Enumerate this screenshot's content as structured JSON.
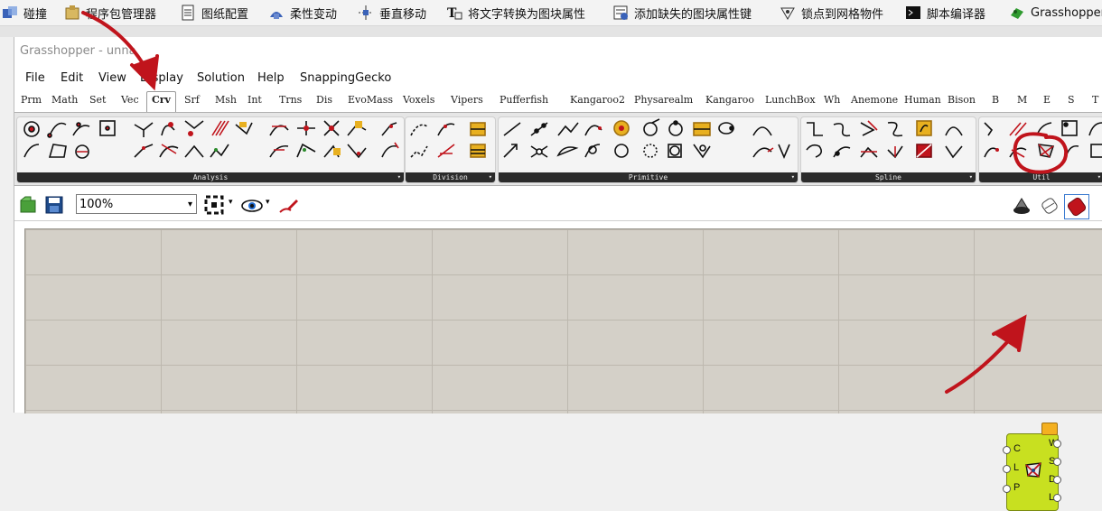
{
  "host_toolbar": {
    "items": [
      {
        "label": "碰撞",
        "icon": "collision-icon"
      },
      {
        "label": "程序包管理器",
        "icon": "package-manager-icon"
      },
      {
        "label": "图纸配置",
        "icon": "drawing-config-icon"
      },
      {
        "label": "柔性变动",
        "icon": "flex-transform-icon"
      },
      {
        "label": "垂直移动",
        "icon": "vertical-move-icon"
      },
      {
        "label": "将文字转换为图块属性",
        "icon": "text-to-block-icon"
      },
      {
        "label": "添加缺失的图块属性键",
        "icon": "add-block-key-icon"
      },
      {
        "label": "锁点到网格物件",
        "icon": "snap-to-mesh-icon"
      },
      {
        "label": "脚本编译器",
        "icon": "script-compiler-icon"
      },
      {
        "label": "Grasshopper",
        "icon": "grasshopper-icon"
      }
    ]
  },
  "window": {
    "title": "Grasshopper - unna"
  },
  "menu": [
    "File",
    "Edit",
    "View",
    "Display",
    "Solution",
    "Help",
    "SnappingGecko"
  ],
  "tabs": [
    "Prm",
    "Math",
    "Set",
    "Vec",
    "Crv",
    "Srf",
    "Msh",
    "Int",
    "Trns",
    "Dis",
    "EvoMass",
    "Voxels",
    "Vipers",
    "Pufferfish",
    "Kangaroo2",
    "Physarealm",
    "Kangaroo",
    "LunchBox",
    "Wh",
    "Anemone",
    "Human",
    "Bison",
    "B",
    "M",
    "E",
    "S",
    "T"
  ],
  "active_tab": "Crv",
  "ribbon_panels": [
    {
      "label": "Analysis"
    },
    {
      "label": "Division"
    },
    {
      "label": "Primitive"
    },
    {
      "label": "Spline"
    },
    {
      "label": "Util"
    }
  ],
  "canvas_toolbar": {
    "zoom": "100%"
  },
  "component": {
    "inputs": [
      "C",
      "L",
      "P"
    ],
    "outputs": [
      "W",
      "S",
      "D",
      "L"
    ]
  },
  "colors": {
    "annotation": "#c0141c",
    "component": "#c8e020",
    "canvas": "#d4d0c8"
  }
}
